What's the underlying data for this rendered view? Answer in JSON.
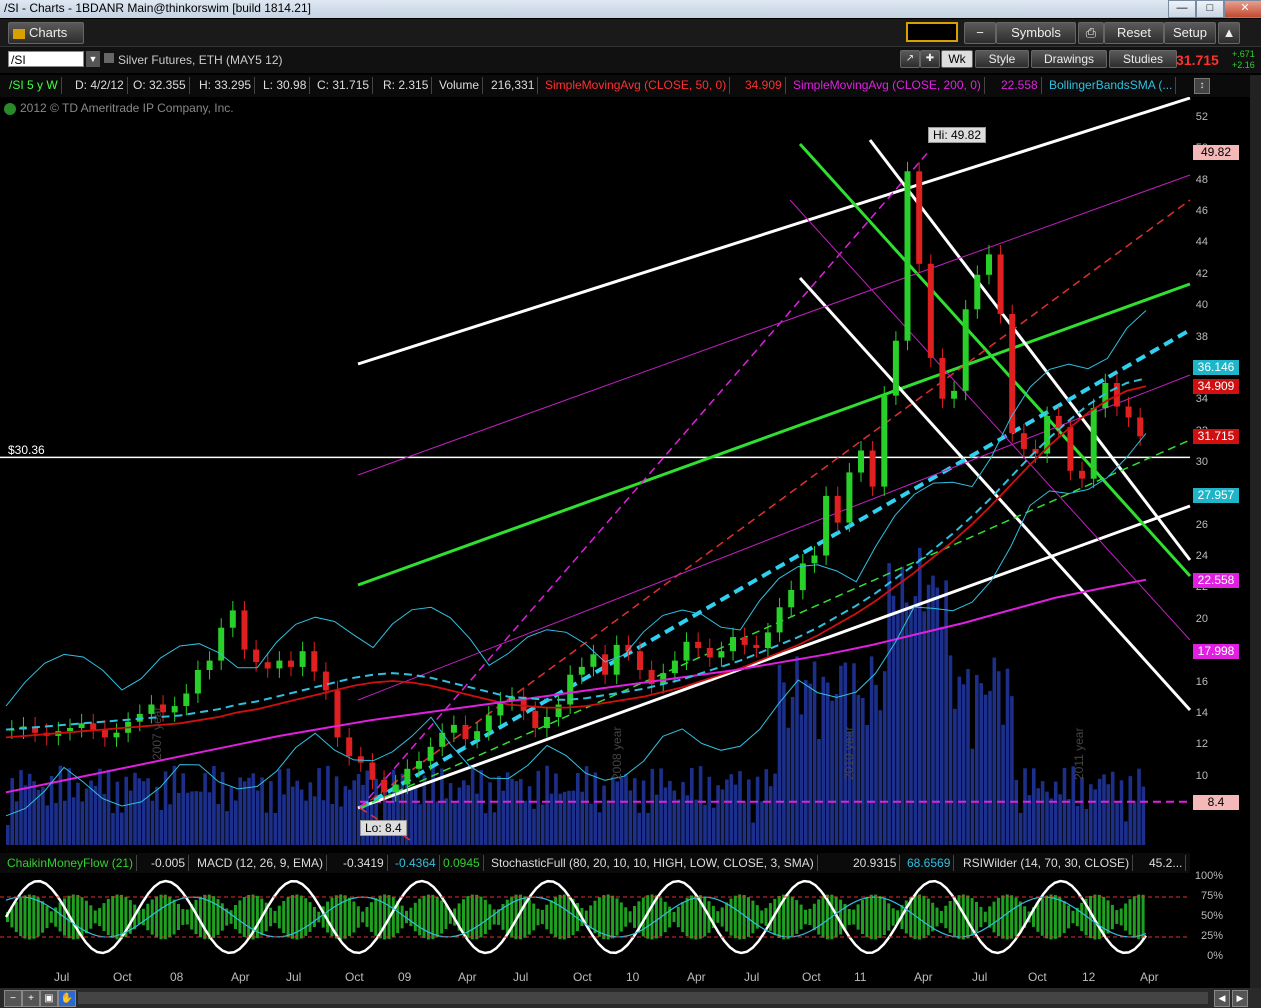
{
  "window": {
    "title": "/SI - Charts - 1BDANR Main@thinkorswim [build 1814.21]"
  },
  "toolbar": {
    "charts_tab": "Charts",
    "symbols_label": "Symbols",
    "reset_label": "Reset",
    "setup_label": "Setup"
  },
  "symbol_bar": {
    "symbol": "/SI",
    "description": "Silver Futures, ETH (MAY5 12)",
    "timeframe": "Wk",
    "style_label": "Style",
    "drawings_label": "Drawings",
    "studies_label": "Studies",
    "last_price": "31.715",
    "change_top": "+.671",
    "change_bottom": "+2.16"
  },
  "info_bar": {
    "period": "/SI 5 y W",
    "date": "D: 4/2/12",
    "open": "O: 32.355",
    "high": "H: 33.295",
    "low": "L: 30.98",
    "close": "C: 31.715",
    "range": "R: 2.315",
    "volume_label": "Volume",
    "volume_value": "216,331",
    "sma50_label": "SimpleMovingAvg (CLOSE, 50, 0)",
    "sma50_value": "34.909",
    "sma200_label": "SimpleMovingAvg (CLOSE, 200, 0)",
    "sma200_value": "22.558",
    "bb_label": "BollingerBandsSMA (..."
  },
  "copyright": "2012 © TD Ameritrade IP Company, Inc.",
  "annotations": {
    "hi": "Hi: 49.82",
    "lo": "Lo: 8.4",
    "horizontal_line": "$30.36",
    "year_labels": [
      "2007 year",
      "2008 year",
      "2010 year",
      "2011 year"
    ]
  },
  "price_badges": [
    {
      "label": "49.82",
      "color": "#f4b8b8",
      "text": "#000"
    },
    {
      "label": "36.146",
      "color": "#1fb5c8",
      "text": "#fff"
    },
    {
      "label": "34.909",
      "color": "#d01010",
      "text": "#fff"
    },
    {
      "label": "31.715",
      "color": "#d01010",
      "text": "#fff"
    },
    {
      "label": "27.957",
      "color": "#1fb5c8",
      "text": "#fff"
    },
    {
      "label": "22.558",
      "color": "#e020e0",
      "text": "#fff"
    },
    {
      "label": "17.998",
      "color": "#e020e0",
      "text": "#fff"
    },
    {
      "label": "8.4",
      "color": "#f4b8b8",
      "text": "#000"
    }
  ],
  "lower_bar": {
    "cmf_label": "ChaikinMoneyFlow (21)",
    "cmf_value": "-0.005",
    "macd_label": "MACD (12, 26, 9, EMA)",
    "macd_v1": "-0.3419",
    "macd_v2": "-0.4364",
    "macd_v3": "0.0945",
    "stoch_label": "StochasticFull (80, 20, 10, 10, HIGH, LOW, CLOSE, 3, SMA)",
    "stoch_v1": "20.9315",
    "stoch_v2": "68.6569",
    "rsi_label": "RSIWilder (14, 70, 30, CLOSE)",
    "rsi_value": "45.2..."
  },
  "lower_axis": [
    "100%",
    "75%",
    "50%",
    "25%",
    "0%"
  ],
  "chart_data": {
    "type": "line",
    "title": "/SI 5 y W",
    "x_ticks": [
      "Jul",
      "Oct",
      "08",
      "Apr",
      "Jul",
      "Oct",
      "09",
      "Apr",
      "Jul",
      "Oct",
      "10",
      "Apr",
      "Jul",
      "Oct",
      "11",
      "Apr",
      "Jul",
      "Oct",
      "12",
      "Apr"
    ],
    "y_ticks": [
      52,
      50,
      48,
      46,
      44,
      42,
      40,
      38,
      36,
      34,
      32,
      30,
      28,
      26,
      24,
      22,
      20,
      18,
      16,
      14,
      12,
      10,
      8
    ],
    "ylim": [
      7,
      53
    ],
    "series": [
      {
        "name": "Close",
        "color": "#ffffff",
        "values": [
          13.0,
          13.2,
          12.8,
          12.6,
          12.9,
          13.1,
          13.4,
          13.0,
          12.5,
          12.8,
          13.5,
          14.0,
          14.6,
          14.1,
          14.5,
          15.3,
          16.8,
          17.4,
          19.5,
          20.6,
          18.1,
          17.3,
          16.9,
          17.4,
          17.0,
          18.0,
          16.7,
          15.5,
          12.5,
          11.3,
          10.9,
          9.8,
          9.0,
          9.5,
          10.5,
          11.0,
          11.9,
          12.8,
          13.3,
          12.4,
          12.9,
          13.9,
          14.8,
          15.1,
          14.2,
          13.1,
          13.8,
          14.6,
          16.5,
          17.0,
          17.8,
          16.5,
          18.4,
          18.0,
          16.8,
          15.9,
          16.6,
          17.4,
          18.6,
          18.2,
          17.6,
          18.0,
          18.9,
          18.4,
          18.2,
          19.2,
          20.8,
          21.9,
          23.6,
          24.1,
          27.9,
          26.2,
          29.4,
          30.8,
          28.5,
          34.3,
          37.8,
          48.6,
          42.7,
          36.7,
          34.1,
          34.6,
          39.8,
          42.0,
          43.3,
          39.5,
          31.9,
          30.9,
          30.6,
          33.0,
          32.3,
          29.5,
          29.0,
          33.5,
          35.1,
          33.6,
          32.9,
          31.7
        ]
      },
      {
        "name": "SimpleMovingAvg (CLOSE, 50, 0)",
        "color": "#d01010",
        "values": [
          12.5,
          12.6,
          12.7,
          12.8,
          12.9,
          13.0,
          13.1,
          13.2,
          13.3,
          13.4,
          13.6,
          13.8,
          14.1,
          14.3,
          14.6,
          14.9,
          15.2,
          15.5,
          15.8,
          16.0,
          16.1,
          16.0,
          15.8,
          15.5,
          15.2,
          14.9,
          14.6,
          14.5,
          14.4,
          14.4,
          14.5,
          14.7,
          14.9,
          15.1,
          15.4,
          15.7,
          16.1,
          16.5,
          16.9,
          17.4,
          17.9,
          18.4,
          19.0,
          19.7,
          20.4,
          21.2,
          22.1,
          23.0,
          24.0,
          25.0,
          26.1,
          27.3,
          28.6,
          29.9,
          31.1,
          32.2,
          33.2,
          34.0,
          34.6,
          34.9
        ]
      },
      {
        "name": "SimpleMovingAvg (CLOSE, 200, 0)",
        "color": "#e020e0",
        "values": [
          9.0,
          9.6,
          10.2,
          10.8,
          11.4,
          12.0,
          12.6,
          13.1,
          13.6,
          14.0,
          14.4,
          14.8,
          15.2,
          15.6,
          16.0,
          16.4,
          16.8,
          17.3,
          17.8,
          18.4,
          19.1,
          19.8,
          20.6,
          21.4,
          22.0,
          22.558
        ]
      }
    ],
    "hi": 49.82,
    "lo": 8.4,
    "horizontal_line": 30.36
  }
}
